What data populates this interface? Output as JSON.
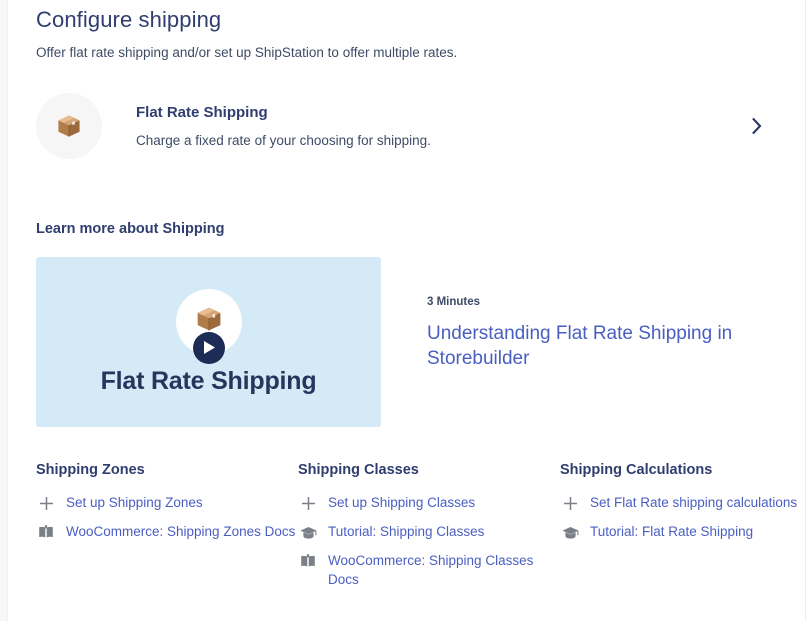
{
  "page": {
    "title": "Configure shipping",
    "subtitle": "Offer flat rate shipping and/or set up ShipStation to offer multiple rates."
  },
  "shipping_method": {
    "icon": "package-box-icon",
    "name": "Flat Rate Shipping",
    "description": "Charge a fixed rate of your choosing for shipping.",
    "chevron_icon": "chevron-right-icon"
  },
  "learn_more": {
    "heading": "Learn more about Shipping",
    "video": {
      "thumbnail_caption": "Flat Rate Shipping",
      "thumbnail_icon": "package-box-icon",
      "play_icon": "play-icon",
      "duration": "3 Minutes",
      "title": "Understanding Flat Rate Shipping in Storebuilder"
    }
  },
  "resources": [
    {
      "title": "Shipping Zones",
      "links": [
        {
          "icon": "plus-icon",
          "label": "Set up Shipping Zones"
        },
        {
          "icon": "book-icon",
          "label": "WooCommerce: Shipping Zones Docs"
        }
      ]
    },
    {
      "title": "Shipping Classes",
      "links": [
        {
          "icon": "plus-icon",
          "label": "Set up Shipping Classes"
        },
        {
          "icon": "graduation-cap-icon",
          "label": "Tutorial: Shipping Classes"
        },
        {
          "icon": "book-icon",
          "label": "WooCommerce: Shipping Classes Docs"
        }
      ]
    },
    {
      "title": "Shipping Calculations",
      "links": [
        {
          "icon": "plus-icon",
          "label": "Set Flat Rate shipping calculations"
        },
        {
          "icon": "graduation-cap-icon",
          "label": "Tutorial: Flat Rate Shipping"
        }
      ]
    }
  ],
  "colors": {
    "heading": "#2f3e6e",
    "body_text": "#3d4b66",
    "link": "#4a5ec2",
    "video_card_bg": "#d4eaf6",
    "play_button": "#1d2c56",
    "avatar_bg": "#f6f6f6",
    "icon_gray": "#7b7f87",
    "box_brown": "#b5804e"
  }
}
